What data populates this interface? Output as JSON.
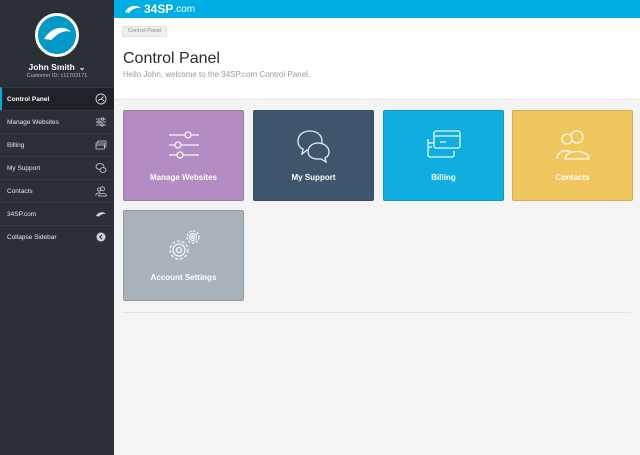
{
  "brand": {
    "logo_text": "34SP",
    "logo_suffix": ".com",
    "accent_color": "#00aee6",
    "sidebar_bg": "#2b2f36"
  },
  "user": {
    "name": "John Smith",
    "customer_id": "Customer ID: c11703171"
  },
  "sidebar": {
    "items": [
      {
        "label": "Control Panel",
        "icon": "dashboard-icon",
        "active": true
      },
      {
        "label": "Manage Websites",
        "icon": "sliders-icon"
      },
      {
        "label": "Billing",
        "icon": "credit-card-icon"
      },
      {
        "label": "My Support",
        "icon": "chat-bubbles-icon"
      },
      {
        "label": "Contacts",
        "icon": "people-icon"
      },
      {
        "label": "34SP.com",
        "icon": "34sp-logo-icon"
      },
      {
        "label": "Collapse Sidebar",
        "icon": "collapse-arrow-icon"
      }
    ]
  },
  "header": {
    "breadcrumb": "Control Panel",
    "title": "Control Panel",
    "welcome": "Hello John, welcome to the 34SP.com Control Panel."
  },
  "tiles": [
    {
      "label": "Manage Websites",
      "icon": "sliders-icon",
      "color": "#b28cc2"
    },
    {
      "label": "My Support",
      "icon": "chat-bubbles-icon",
      "color": "#3d566b"
    },
    {
      "label": "Billing",
      "icon": "credit-card-icon",
      "color": "#10aee0"
    },
    {
      "label": "Contacts",
      "icon": "people-icon",
      "color": "#f0c75e"
    },
    {
      "label": "Account Settings",
      "icon": "gears-icon",
      "color": "#a8b2b8"
    }
  ]
}
